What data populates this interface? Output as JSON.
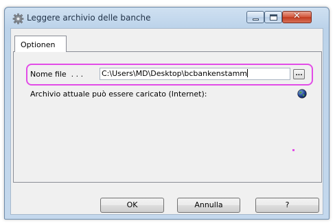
{
  "window": {
    "title": "Leggere archivio delle banche",
    "close_glyph": "✕"
  },
  "icons": {
    "app": "gear-icon",
    "minimize": "minimize-icon",
    "maximize": "maximize-icon",
    "close": "close-icon",
    "browse": "ellipsis-icon",
    "internet": "globe-icon"
  },
  "tabs": [
    {
      "label": "Optionen",
      "selected": true
    }
  ],
  "form": {
    "file_label": "Nome file  . . .",
    "file_value": "C:\\Users\\MD\\Desktop\\bcbankenstamm",
    "browse_label": "...",
    "internet_label": "Archivio attuale può essere caricato (Internet):"
  },
  "buttons": {
    "ok": "OK",
    "cancel": "Annulla",
    "help": "?"
  },
  "colors": {
    "highlight": "#e24be7",
    "close_button": "#c94a2e",
    "window_frame": "#bcd3ea"
  }
}
